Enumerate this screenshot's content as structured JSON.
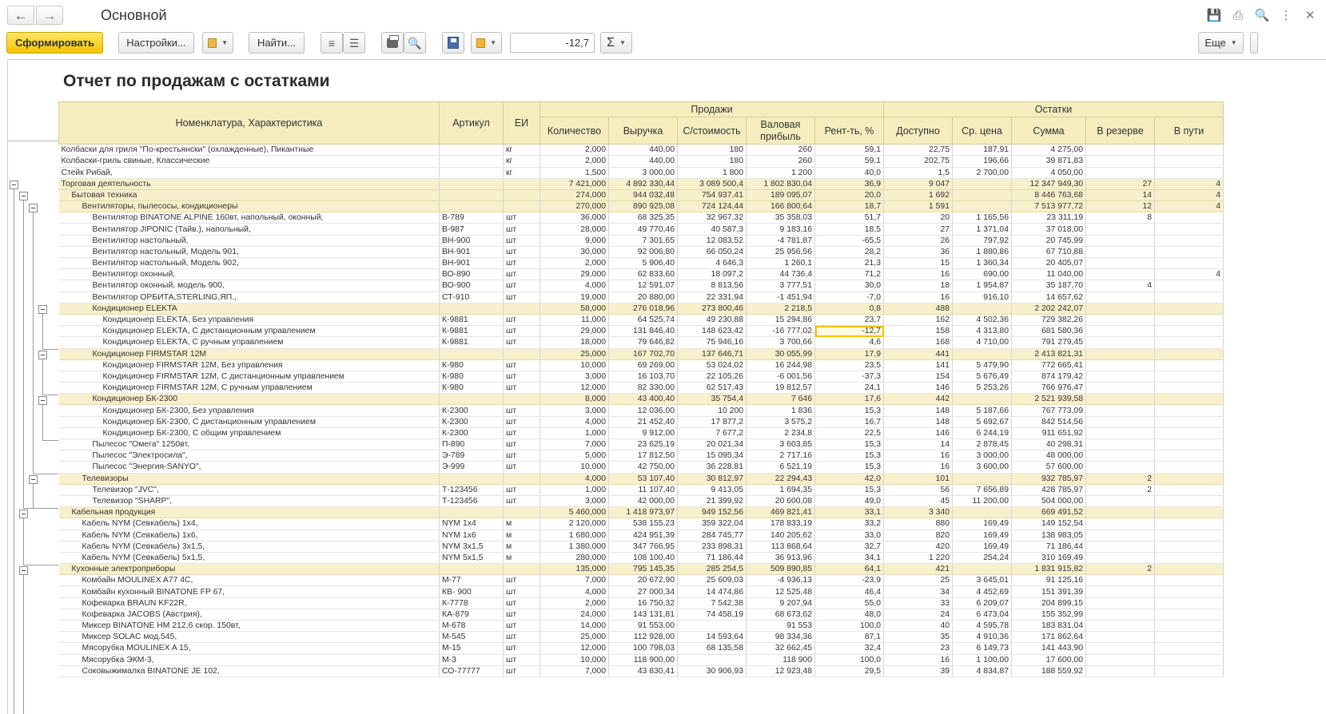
{
  "window": {
    "title": "Основной"
  },
  "toolbar": {
    "generate_label": "Сформировать",
    "settings_label": "Настройки...",
    "find_label": "Найти...",
    "value_field": "-12,7",
    "sum_label": "Σ",
    "more_label": "Еще"
  },
  "report": {
    "title": "Отчет по продажам с остатками",
    "headers": {
      "name": "Номенклатура, Характеристика",
      "article": "Артикул",
      "unit": "ЕИ",
      "sales": "Продажи",
      "stock": "Остатки",
      "qty": "Количество",
      "revenue": "Выручка",
      "cost": "С/стоимость",
      "gross": "Валовая прибыль",
      "margin": "Рент-ть, %",
      "available": "Доступно",
      "avg_price": "Ср. цена",
      "sum": "Сумма",
      "reserve": "В резерве",
      "transit": "В пути"
    },
    "rows": [
      {
        "n": "Колбаски для гриля \"По-крестьянски\" (охлажденные), Пикантные",
        "a": "",
        "u": "кг",
        "q": "2,000",
        "r": "440,00",
        "c": "180",
        "g": "260",
        "m": "59,1",
        "d": "22,75",
        "p": "187,91",
        "s": "4 275,00",
        "rv": "",
        "t": "",
        "lv": 0,
        "grp": false
      },
      {
        "n": "Колбаски-гриль свиные, Классические",
        "a": "",
        "u": "кг",
        "q": "2,000",
        "r": "440,00",
        "c": "180",
        "g": "260",
        "m": "59,1",
        "d": "202,75",
        "p": "196,66",
        "s": "39 871,83",
        "rv": "",
        "t": "",
        "lv": 0,
        "grp": false
      },
      {
        "n": "Стейк Рибай,",
        "a": "",
        "u": "кг",
        "q": "1,500",
        "r": "3 000,00",
        "c": "1 800",
        "g": "1 200",
        "m": "40,0",
        "d": "1,5",
        "p": "2 700,00",
        "s": "4 050,00",
        "rv": "",
        "t": "",
        "lv": 0,
        "grp": false
      },
      {
        "n": "Торговая деятельность",
        "a": "",
        "u": "",
        "q": "7 421,000",
        "r": "4 892 330,44",
        "c": "3 089 500,4",
        "g": "1 802 830,04",
        "m": "36,9",
        "d": "9 047",
        "p": "",
        "s": "12 347 949,30",
        "rv": "27",
        "t": "4",
        "lv": 0,
        "grp": true
      },
      {
        "n": "Бытовая техника",
        "a": "",
        "u": "",
        "q": "274,000",
        "r": "944 032,48",
        "c": "754 937,41",
        "g": "189 095,07",
        "m": "20,0",
        "d": "1 692",
        "p": "",
        "s": "8 446 763,68",
        "rv": "14",
        "t": "4",
        "lv": 1,
        "grp": true
      },
      {
        "n": "Вентиляторы, пылесосы, кондиционеры",
        "a": "",
        "u": "",
        "q": "270,000",
        "r": "890 925,08",
        "c": "724 124,44",
        "g": "166 800,64",
        "m": "18,7",
        "d": "1 591",
        "p": "",
        "s": "7 513 977,72",
        "rv": "12",
        "t": "4",
        "lv": 2,
        "grp": true
      },
      {
        "n": "Вентилятор BINATONE ALPINE 160вт, напольный, оконный,",
        "a": "В-789",
        "u": "шт",
        "q": "36,000",
        "r": "68 325,35",
        "c": "32 967,32",
        "g": "35 358,03",
        "m": "51,7",
        "d": "20",
        "p": "1 165,56",
        "s": "23 311,19",
        "rv": "8",
        "t": "",
        "lv": 3,
        "grp": false
      },
      {
        "n": "Вентилятор JIPONIC (Тайв.), напольный,",
        "a": "В-987",
        "u": "шт",
        "q": "28,000",
        "r": "49 770,46",
        "c": "40 587,3",
        "g": "9 183,16",
        "m": "18,5",
        "d": "27",
        "p": "1 371,04",
        "s": "37 018,00",
        "rv": "",
        "t": "",
        "lv": 3,
        "grp": false
      },
      {
        "n": "Вентилятор настольный,",
        "a": "ВН-900",
        "u": "шт",
        "q": "9,000",
        "r": "7 301,65",
        "c": "12 083,52",
        "g": "-4 781,87",
        "m": "-65,5",
        "d": "26",
        "p": "797,92",
        "s": "20 745,99",
        "rv": "",
        "t": "",
        "lv": 3,
        "grp": false
      },
      {
        "n": "Вентилятор настольный, Модель 901,",
        "a": "ВН-901",
        "u": "шт",
        "q": "30,000",
        "r": "92 006,80",
        "c": "66 050,24",
        "g": "25 956,56",
        "m": "28,2",
        "d": "36",
        "p": "1 880,86",
        "s": "67 710,88",
        "rv": "",
        "t": "",
        "lv": 3,
        "grp": false
      },
      {
        "n": "Вентилятор настольный, Модель 902,",
        "a": "ВН-901",
        "u": "шт",
        "q": "2,000",
        "r": "5 906,40",
        "c": "4 646,3",
        "g": "1 260,1",
        "m": "21,3",
        "d": "15",
        "p": "1 360,34",
        "s": "20 405,07",
        "rv": "",
        "t": "",
        "lv": 3,
        "grp": false
      },
      {
        "n": "Вентилятор оконный,",
        "a": "ВО-890",
        "u": "шт",
        "q": "29,000",
        "r": "62 833,60",
        "c": "18 097,2",
        "g": "44 736,4",
        "m": "71,2",
        "d": "16",
        "p": "690,00",
        "s": "11 040,00",
        "rv": "",
        "t": "4",
        "lv": 3,
        "grp": false
      },
      {
        "n": "Вентилятор оконный, модель 900,",
        "a": "ВО-900",
        "u": "шт",
        "q": "4,000",
        "r": "12 591,07",
        "c": "8 813,56",
        "g": "3 777,51",
        "m": "30,0",
        "d": "18",
        "p": "1 954,87",
        "s": "35 187,70",
        "rv": "4",
        "t": "",
        "lv": 3,
        "grp": false
      },
      {
        "n": "Вентилятор ОРБИТА,STERLING,ЯП.,",
        "a": "СТ-910",
        "u": "шт",
        "q": "19,000",
        "r": "20 880,00",
        "c": "22 331,94",
        "g": "-1 451,94",
        "m": "-7,0",
        "d": "16",
        "p": "916,10",
        "s": "14 657,62",
        "rv": "",
        "t": "",
        "lv": 3,
        "grp": false
      },
      {
        "n": "Кондиционер ELEKTA",
        "a": "",
        "u": "",
        "q": "58,000",
        "r": "276 018,96",
        "c": "273 800,46",
        "g": "2 218,5",
        "m": "0,8",
        "d": "488",
        "p": "",
        "s": "2 202 242,07",
        "rv": "",
        "t": "",
        "lv": 3,
        "grp": true
      },
      {
        "n": "Кондиционер ELEKTA, Без управления",
        "a": "К-9881",
        "u": "шт",
        "q": "11,000",
        "r": "64 525,74",
        "c": "49 230,88",
        "g": "15 294,86",
        "m": "23,7",
        "d": "162",
        "p": "4 502,36",
        "s": "729 382,26",
        "rv": "",
        "t": "",
        "lv": 4,
        "grp": false
      },
      {
        "n": "Кондиционер ELEKTA, С дистанционным управлением",
        "a": "К-9881",
        "u": "шт",
        "q": "29,000",
        "r": "131 846,40",
        "c": "148 623,42",
        "g": "-16 777,02",
        "m": "-12,7",
        "d": "158",
        "p": "4 313,80",
        "s": "681 580,36",
        "rv": "",
        "t": "",
        "lv": 4,
        "grp": false,
        "sel": true
      },
      {
        "n": "Кондиционер ELEKTA, С ручным управлением",
        "a": "К-9881",
        "u": "шт",
        "q": "18,000",
        "r": "79 646,82",
        "c": "75 946,16",
        "g": "3 700,66",
        "m": "4,6",
        "d": "168",
        "p": "4 710,00",
        "s": "791 279,45",
        "rv": "",
        "t": "",
        "lv": 4,
        "grp": false
      },
      {
        "n": "Кондиционер FIRMSTAR 12M",
        "a": "",
        "u": "",
        "q": "25,000",
        "r": "167 702,70",
        "c": "137 646,71",
        "g": "30 055,99",
        "m": "17,9",
        "d": "441",
        "p": "",
        "s": "2 413 821,31",
        "rv": "",
        "t": "",
        "lv": 3,
        "grp": true
      },
      {
        "n": "Кондиционер FIRMSTAR 12M, Без управления",
        "a": "К-980",
        "u": "шт",
        "q": "10,000",
        "r": "69 269,00",
        "c": "53 024,02",
        "g": "16 244,98",
        "m": "23,5",
        "d": "141",
        "p": "5 479,90",
        "s": "772 665,41",
        "rv": "",
        "t": "",
        "lv": 4,
        "grp": false
      },
      {
        "n": "Кондиционер FIRMSTAR 12M, С дистанционным управлением",
        "a": "К-980",
        "u": "шт",
        "q": "3,000",
        "r": "16 103,70",
        "c": "22 105,26",
        "g": "-6 001,56",
        "m": "-37,3",
        "d": "154",
        "p": "5 676,49",
        "s": "874 179,42",
        "rv": "",
        "t": "",
        "lv": 4,
        "grp": false
      },
      {
        "n": "Кондиционер FIRMSTAR 12M, С ручным управлением",
        "a": "К-980",
        "u": "шт",
        "q": "12,000",
        "r": "82 330,00",
        "c": "62 517,43",
        "g": "19 812,57",
        "m": "24,1",
        "d": "146",
        "p": "5 253,26",
        "s": "766 976,47",
        "rv": "",
        "t": "",
        "lv": 4,
        "grp": false
      },
      {
        "n": "Кондиционер БК-2300",
        "a": "",
        "u": "",
        "q": "8,000",
        "r": "43 400,40",
        "c": "35 754,4",
        "g": "7 646",
        "m": "17,6",
        "d": "442",
        "p": "",
        "s": "2 521 939,58",
        "rv": "",
        "t": "",
        "lv": 3,
        "grp": true
      },
      {
        "n": "Кондиционер БК-2300, Без управления",
        "a": "К-2300",
        "u": "шт",
        "q": "3,000",
        "r": "12 036,00",
        "c": "10 200",
        "g": "1 836",
        "m": "15,3",
        "d": "148",
        "p": "5 187,66",
        "s": "767 773,09",
        "rv": "",
        "t": "",
        "lv": 4,
        "grp": false
      },
      {
        "n": "Кондиционер БК-2300, С дистанционным управлением",
        "a": "К-2300",
        "u": "шт",
        "q": "4,000",
        "r": "21 452,40",
        "c": "17 877,2",
        "g": "3 575,2",
        "m": "16,7",
        "d": "148",
        "p": "5 692,67",
        "s": "842 514,56",
        "rv": "",
        "t": "",
        "lv": 4,
        "grp": false
      },
      {
        "n": "Кондиционер БК-2300, С общим управлением",
        "a": "К-2300",
        "u": "шт",
        "q": "1,000",
        "r": "9 912,00",
        "c": "7 677,2",
        "g": "2 234,8",
        "m": "22,5",
        "d": "146",
        "p": "6 244,19",
        "s": "911 651,92",
        "rv": "",
        "t": "",
        "lv": 4,
        "grp": false
      },
      {
        "n": "Пылесос \"Омега\" 1250вт,",
        "a": "П-890",
        "u": "шт",
        "q": "7,000",
        "r": "23 625,19",
        "c": "20 021,34",
        "g": "3 603,85",
        "m": "15,3",
        "d": "14",
        "p": "2 878,45",
        "s": "40 298,31",
        "rv": "",
        "t": "",
        "lv": 3,
        "grp": false
      },
      {
        "n": "Пылесос \"Электросила\",",
        "a": "Э-789",
        "u": "шт",
        "q": "5,000",
        "r": "17 812,50",
        "c": "15 095,34",
        "g": "2 717,16",
        "m": "15,3",
        "d": "16",
        "p": "3 000,00",
        "s": "48 000,00",
        "rv": "",
        "t": "",
        "lv": 3,
        "grp": false
      },
      {
        "n": "Пылесос \"Энергия-SANYO\",",
        "a": "Э-999",
        "u": "шт",
        "q": "10,000",
        "r": "42 750,00",
        "c": "36 228,81",
        "g": "6 521,19",
        "m": "15,3",
        "d": "16",
        "p": "3 600,00",
        "s": "57 600,00",
        "rv": "",
        "t": "",
        "lv": 3,
        "grp": false
      },
      {
        "n": "Телевизоры",
        "a": "",
        "u": "",
        "q": "4,000",
        "r": "53 107,40",
        "c": "30 812,97",
        "g": "22 294,43",
        "m": "42,0",
        "d": "101",
        "p": "",
        "s": "932 785,97",
        "rv": "2",
        "t": "",
        "lv": 2,
        "grp": true
      },
      {
        "n": "Телевизор \"JVC\",",
        "a": "Т-123456",
        "u": "шт",
        "q": "1,000",
        "r": "11 107,40",
        "c": "9 413,05",
        "g": "1 694,35",
        "m": "15,3",
        "d": "56",
        "p": "7 656,89",
        "s": "428 785,97",
        "rv": "2",
        "t": "",
        "lv": 3,
        "grp": false
      },
      {
        "n": "Телевизор \"SHARP\",",
        "a": "Т-123456",
        "u": "шт",
        "q": "3,000",
        "r": "42 000,00",
        "c": "21 399,92",
        "g": "20 600,08",
        "m": "49,0",
        "d": "45",
        "p": "11 200,00",
        "s": "504 000,00",
        "rv": "",
        "t": "",
        "lv": 3,
        "grp": false
      },
      {
        "n": "Кабельная продукция",
        "a": "",
        "u": "",
        "q": "5 460,000",
        "r": "1 418 973,97",
        "c": "949 152,56",
        "g": "469 821,41",
        "m": "33,1",
        "d": "3 340",
        "p": "",
        "s": "669 491,52",
        "rv": "",
        "t": "",
        "lv": 1,
        "grp": true
      },
      {
        "n": "Кабель NYM (Севкабель) 1х4,",
        "a": "NYM 1х4",
        "u": "м",
        "q": "2 120,000",
        "r": "538 155,23",
        "c": "359 322,04",
        "g": "178 833,19",
        "m": "33,2",
        "d": "880",
        "p": "169,49",
        "s": "149 152,54",
        "rv": "",
        "t": "",
        "lv": 2,
        "grp": false
      },
      {
        "n": "Кабель NYM (Севкабель) 1х6,",
        "a": "NYM 1х6",
        "u": "м",
        "q": "1 680,000",
        "r": "424 951,39",
        "c": "284 745,77",
        "g": "140 205,62",
        "m": "33,0",
        "d": "820",
        "p": "169,49",
        "s": "138 983,05",
        "rv": "",
        "t": "",
        "lv": 2,
        "grp": false
      },
      {
        "n": "Кабель NYM (Севкабель) 3х1,5,",
        "a": "NYM 3х1,5",
        "u": "м",
        "q": "1 380,000",
        "r": "347 766,95",
        "c": "233 898,31",
        "g": "113 868,64",
        "m": "32,7",
        "d": "420",
        "p": "169,49",
        "s": "71 186,44",
        "rv": "",
        "t": "",
        "lv": 2,
        "grp": false
      },
      {
        "n": "Кабель NYM (Севкабель) 5х1,5,",
        "a": " NYM 5х1,5",
        "u": "м",
        "q": "280,000",
        "r": "108 100,40",
        "c": "71 186,44",
        "g": "36 913,96",
        "m": "34,1",
        "d": "1 220",
        "p": "254,24",
        "s": "310 169,49",
        "rv": "",
        "t": "",
        "lv": 2,
        "grp": false
      },
      {
        "n": "Кухонные электроприборы",
        "a": "",
        "u": "",
        "q": "135,000",
        "r": "795 145,35",
        "c": "285 254,5",
        "g": "509 890,85",
        "m": "64,1",
        "d": "421",
        "p": "",
        "s": "1 831 915,82",
        "rv": "2",
        "t": "",
        "lv": 1,
        "grp": true
      },
      {
        "n": "Комбайн MOULINEX A77 4C,",
        "a": "М-77",
        "u": "шт",
        "q": "7,000",
        "r": "20 672,90",
        "c": "25 609,03",
        "g": "-4 936,13",
        "m": "-23,9",
        "d": "25",
        "p": "3 645,01",
        "s": "91 125,16",
        "rv": "",
        "t": "",
        "lv": 2,
        "grp": false
      },
      {
        "n": "Комбайн кухонный BINATONE FP 67,",
        "a": "КВ- 900",
        "u": "шт",
        "q": "4,000",
        "r": "27 000,34",
        "c": "14 474,86",
        "g": "12 525,48",
        "m": "46,4",
        "d": "34",
        "p": "4 452,69",
        "s": "151 391,39",
        "rv": "",
        "t": "",
        "lv": 2,
        "grp": false
      },
      {
        "n": "Кофеварка BRAUN KF22R,",
        "a": "К-7778",
        "u": "шт",
        "q": "2,000",
        "r": "16 750,32",
        "c": "7 542,38",
        "g": "9 207,94",
        "m": "55,0",
        "d": "33",
        "p": "6 209,07",
        "s": "204 899,15",
        "rv": "",
        "t": "",
        "lv": 2,
        "grp": false
      },
      {
        "n": "Кофеварка JACOBS (Австрия),",
        "a": "КА-879",
        "u": "шт",
        "q": "24,000",
        "r": "143 131,81",
        "c": "74 458,19",
        "g": "68 673,62",
        "m": "48,0",
        "d": "24",
        "p": "6 473,04",
        "s": "155 352,99",
        "rv": "",
        "t": "",
        "lv": 2,
        "grp": false
      },
      {
        "n": "Миксер BINATONE HM 212,6 скор. 150вт,",
        "a": "М-678",
        "u": "шт",
        "q": "14,000",
        "r": "91 553,00",
        "c": "",
        "g": "91 553",
        "m": "100,0",
        "d": "40",
        "p": "4 595,78",
        "s": "183 831,04",
        "rv": "",
        "t": "",
        "lv": 2,
        "grp": false
      },
      {
        "n": "Миксер SOLAC мод.545,",
        "a": "М-545",
        "u": "шт",
        "q": "25,000",
        "r": "112 928,00",
        "c": "14 593,64",
        "g": "98 334,36",
        "m": "87,1",
        "d": "35",
        "p": "4 910,36",
        "s": "171 862,64",
        "rv": "",
        "t": "",
        "lv": 2,
        "grp": false
      },
      {
        "n": "Мясорубка MOULINEX A 15,",
        "a": "М-15",
        "u": "шт",
        "q": "12,000",
        "r": "100 798,03",
        "c": "68 135,58",
        "g": "32 662,45",
        "m": "32,4",
        "d": "23",
        "p": "6 149,73",
        "s": "141 443,90",
        "rv": "",
        "t": "",
        "lv": 2,
        "grp": false
      },
      {
        "n": "Мясорубка ЭКМ-3,",
        "a": "М-3",
        "u": "шт",
        "q": "10,000",
        "r": "118 900,00",
        "c": "",
        "g": "118 900",
        "m": "100,0",
        "d": "16",
        "p": "1 100,00",
        "s": "17 600,00",
        "rv": "",
        "t": "",
        "lv": 2,
        "grp": false
      },
      {
        "n": "Соковыжималка BINATONE JE 102,",
        "a": "СО-77777",
        "u": "шт",
        "q": "7,000",
        "r": "43 830,41",
        "c": "30 906,93",
        "g": "12 923,48",
        "m": "29,5",
        "d": "39",
        "p": "4 834,87",
        "s": "188 559,92",
        "rv": "",
        "t": "",
        "lv": 2,
        "grp": false
      }
    ]
  }
}
